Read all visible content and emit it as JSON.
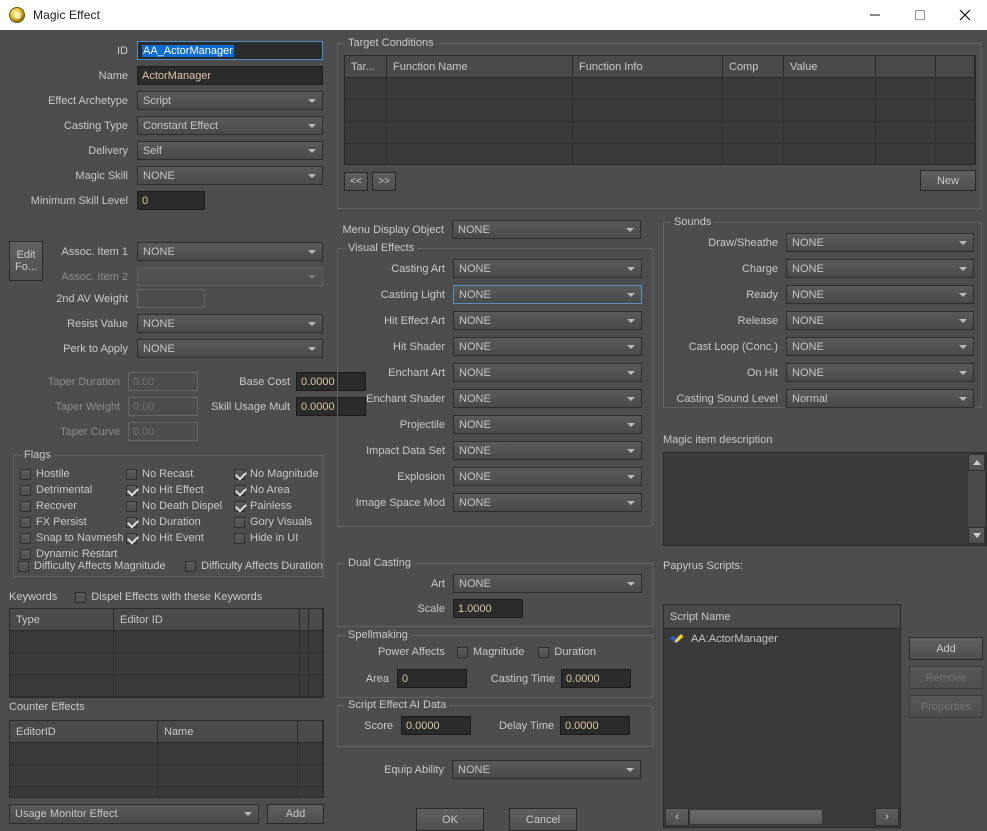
{
  "window": {
    "title": "Magic Effect",
    "icon": "magic-effect-icon",
    "minimize": "–",
    "maximize": "□",
    "close": "✕"
  },
  "left": {
    "fields": [
      {
        "label": "ID",
        "type": "text",
        "value": "AA_ActorManager",
        "selected": true,
        "focused": true
      },
      {
        "label": "Name",
        "type": "text",
        "value": "ActorManager"
      },
      {
        "label": "Effect Archetype",
        "type": "combo",
        "value": "Script"
      },
      {
        "label": "Casting Type",
        "type": "combo",
        "value": "Constant Effect"
      },
      {
        "label": "Delivery",
        "type": "combo",
        "value": "Self"
      },
      {
        "label": "Magic Skill",
        "type": "combo",
        "value": "NONE"
      },
      {
        "label": "Minimum Skill Level",
        "type": "text",
        "value": "0"
      },
      {
        "label": "Assoc. Item 1",
        "type": "combo",
        "value": "NONE"
      },
      {
        "label": "Assoc. Item 2",
        "type": "combo",
        "value": "",
        "disabled": true
      },
      {
        "label": "2nd AV Weight",
        "type": "text",
        "value": "",
        "disabled": true
      },
      {
        "label": "Resist Value",
        "type": "combo",
        "value": "NONE"
      },
      {
        "label": "Perk to Apply",
        "type": "combo",
        "value": "NONE"
      }
    ],
    "edit_formula_button": "Edit\nFo...",
    "taper": [
      {
        "label": "Taper Duration",
        "value": "0.00",
        "disabled": true
      },
      {
        "label": "Taper Weight",
        "value": "0.00",
        "disabled": true
      },
      {
        "label": "Taper Curve",
        "value": "0.00",
        "disabled": true
      }
    ],
    "costs": [
      {
        "label": "Base Cost",
        "value": "0.0000"
      },
      {
        "label": "Skill Usage Mult",
        "value": "0.0000"
      }
    ]
  },
  "flags": {
    "title": "Flags",
    "col1": [
      {
        "label": "Hostile",
        "checked": false
      },
      {
        "label": "Detrimental",
        "checked": false
      },
      {
        "label": "Recover",
        "checked": false
      },
      {
        "label": "FX Persist",
        "checked": false
      },
      {
        "label": "Snap to Navmesh",
        "checked": false
      },
      {
        "label": "Dynamic Restart",
        "checked": false
      }
    ],
    "col2": [
      {
        "label": "No Recast",
        "checked": false
      },
      {
        "label": "No Hit Effect",
        "checked": true
      },
      {
        "label": "No Death Dispel",
        "checked": false
      },
      {
        "label": "No Duration",
        "checked": true
      },
      {
        "label": "No Hit Event",
        "checked": true
      }
    ],
    "col3": [
      {
        "label": "No Magnitude",
        "checked": true
      },
      {
        "label": "No Area",
        "checked": true
      },
      {
        "label": "Painless",
        "checked": true
      },
      {
        "label": "Gory Visuals",
        "checked": false
      },
      {
        "label": "Hide in UI",
        "checked": false
      }
    ],
    "bottom": [
      {
        "label": "Difficulty Affects Magnitude",
        "checked": false
      },
      {
        "label": "Difficulty Affects Duration",
        "checked": false
      }
    ]
  },
  "keywords": {
    "title": "Keywords",
    "dispel_checkbox": {
      "label": "Dispel Effects with these Keywords",
      "checked": false
    },
    "columns": [
      "Type",
      "Editor ID"
    ],
    "rows": []
  },
  "counter_effects": {
    "title": "Counter Effects",
    "columns": [
      "EditorID",
      "Name"
    ],
    "rows": [],
    "selector_value": "Usage Monitor Effect",
    "add_label": "Add"
  },
  "target_conditions": {
    "title": "Target Conditions",
    "columns": [
      "Tar...",
      "Function Name",
      "Function Info",
      "Comp",
      "Value",
      "",
      ""
    ],
    "rows": [],
    "prev_label": "<<",
    "next_label": ">>",
    "new_label": "New"
  },
  "middle": {
    "menu_display_object": {
      "label": "Menu Display Object",
      "value": "NONE"
    },
    "visual_effects": {
      "title": "Visual Effects",
      "fields": [
        {
          "label": "Casting Art",
          "value": "NONE"
        },
        {
          "label": "Casting Light",
          "value": "NONE",
          "focused": true
        },
        {
          "label": "Hit Effect Art",
          "value": "NONE"
        },
        {
          "label": "Hit Shader",
          "value": "NONE"
        },
        {
          "label": "Enchant Art",
          "value": "NONE"
        },
        {
          "label": "Enchant Shader",
          "value": "NONE"
        },
        {
          "label": "Projectile",
          "value": "NONE"
        },
        {
          "label": "Impact Data Set",
          "value": "NONE"
        },
        {
          "label": "Explosion",
          "value": "NONE"
        },
        {
          "label": "Image Space Mod",
          "value": "NONE"
        }
      ]
    },
    "dual_casting": {
      "title": "Dual Casting",
      "art": {
        "label": "Art",
        "value": "NONE"
      },
      "scale": {
        "label": "Scale",
        "value": "1.0000"
      }
    },
    "spellmaking": {
      "title": "Spellmaking",
      "power_affects_label": "Power Affects",
      "magnitude": {
        "label": "Magnitude",
        "checked": false
      },
      "duration": {
        "label": "Duration",
        "checked": false
      },
      "area": {
        "label": "Area",
        "value": "0"
      },
      "casting_time": {
        "label": "Casting Time",
        "value": "0.0000"
      }
    },
    "script_effect_ai": {
      "title": "Script Effect AI Data",
      "score": {
        "label": "Score",
        "value": "0.0000"
      },
      "delay_time": {
        "label": "Delay Time",
        "value": "0.0000"
      }
    },
    "equip_ability": {
      "label": "Equip Ability",
      "value": "NONE"
    },
    "ok_label": "OK",
    "cancel_label": "Cancel"
  },
  "sounds": {
    "title": "Sounds",
    "fields": [
      {
        "label": "Draw/Sheathe",
        "value": "NONE"
      },
      {
        "label": "Charge",
        "value": "NONE"
      },
      {
        "label": "Ready",
        "value": "NONE"
      },
      {
        "label": "Release",
        "value": "NONE"
      },
      {
        "label": "Cast Loop (Conc.)",
        "value": "NONE"
      },
      {
        "label": "On Hit",
        "value": "NONE"
      },
      {
        "label": "Casting Sound Level",
        "value": "Normal"
      }
    ]
  },
  "description": {
    "label": "Magic item description",
    "value": ""
  },
  "papyrus": {
    "label": "Papyrus Scripts:",
    "column": "Script Name",
    "items": [
      {
        "name": "AA:ActorManager",
        "icon": "script-icon"
      }
    ],
    "add_label": "Add",
    "remove_label": "Remove",
    "properties_label": "Properties",
    "remove_disabled": true,
    "properties_disabled": true
  },
  "colors": {
    "window_bg": "#4d4d4d",
    "field_bg": "#2b2b2b",
    "field_text": "#d9c9a8",
    "selection": "#0a6cd4",
    "focus_border": "#4f8fd0",
    "titlebar_bg": "#ffffff"
  }
}
